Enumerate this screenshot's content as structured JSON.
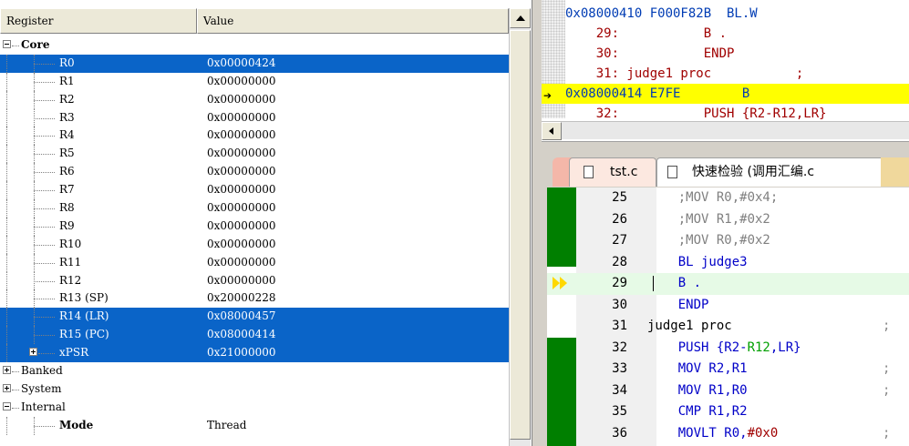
{
  "registers": {
    "header": {
      "register": "Register",
      "value": "Value"
    },
    "rows": [
      {
        "name": "Core",
        "value": "",
        "level": 0,
        "expander": "minus",
        "bold": true,
        "selected": false
      },
      {
        "name": "R0",
        "value": "0x00000424",
        "level": 2,
        "selected": true
      },
      {
        "name": "R1",
        "value": "0x00000000",
        "level": 2,
        "selected": false
      },
      {
        "name": "R2",
        "value": "0x00000000",
        "level": 2,
        "selected": false
      },
      {
        "name": "R3",
        "value": "0x00000000",
        "level": 2,
        "selected": false
      },
      {
        "name": "R4",
        "value": "0x00000000",
        "level": 2,
        "selected": false
      },
      {
        "name": "R5",
        "value": "0x00000000",
        "level": 2,
        "selected": false
      },
      {
        "name": "R6",
        "value": "0x00000000",
        "level": 2,
        "selected": false
      },
      {
        "name": "R7",
        "value": "0x00000000",
        "level": 2,
        "selected": false
      },
      {
        "name": "R8",
        "value": "0x00000000",
        "level": 2,
        "selected": false
      },
      {
        "name": "R9",
        "value": "0x00000000",
        "level": 2,
        "selected": false
      },
      {
        "name": "R10",
        "value": "0x00000000",
        "level": 2,
        "selected": false
      },
      {
        "name": "R11",
        "value": "0x00000000",
        "level": 2,
        "selected": false
      },
      {
        "name": "R12",
        "value": "0x00000000",
        "level": 2,
        "selected": false
      },
      {
        "name": "R13 (SP)",
        "value": "0x20000228",
        "level": 2,
        "selected": false
      },
      {
        "name": "R14 (LR)",
        "value": "0x08000457",
        "level": 2,
        "selected": true
      },
      {
        "name": "R15 (PC)",
        "value": "0x08000414",
        "level": 2,
        "selected": true
      },
      {
        "name": "xPSR",
        "value": "0x21000000",
        "level": 1,
        "expander": "plus",
        "selected": true
      },
      {
        "name": "Banked",
        "value": "",
        "level": 0,
        "expander": "plus",
        "selected": false
      },
      {
        "name": "System",
        "value": "",
        "level": 0,
        "expander": "plus",
        "selected": false
      },
      {
        "name": "Internal",
        "value": "",
        "level": 0,
        "expander": "minus",
        "selected": false
      },
      {
        "name": "Mode",
        "value": "Thread",
        "level": 2,
        "bold": true,
        "selected": false
      }
    ]
  },
  "disassembly": {
    "lines": [
      {
        "text": "0x08000410 F000F82B  BL.W",
        "type": "addr",
        "current": false
      },
      {
        "text": "    29:           B .",
        "type": "src",
        "current": false
      },
      {
        "text": "    30:           ENDP",
        "type": "src",
        "current": false
      },
      {
        "text": "    31: judge1 proc           ;",
        "type": "src",
        "current": false
      },
      {
        "text": "0x08000414 E7FE        B",
        "type": "addr",
        "current": true
      },
      {
        "text": "    32:           PUSH {R2-R12,LR}",
        "type": "src",
        "current": false
      }
    ],
    "current_arrow": "➔"
  },
  "tabs": [
    {
      "label": "tst.c",
      "active": false
    },
    {
      "label": "快速检验 (调用汇编.c",
      "active": true
    }
  ],
  "editor": {
    "lines": [
      {
        "no": "25",
        "parts": [
          {
            "t": "    ;MOV R0,#0x4;",
            "c": "comment"
          }
        ],
        "trail": ""
      },
      {
        "no": "26",
        "parts": [
          {
            "t": "    ;MOV R1,#0x2",
            "c": "comment"
          }
        ],
        "trail": ""
      },
      {
        "no": "27",
        "parts": [
          {
            "t": "    ;MOV R0,#0x2",
            "c": "comment"
          }
        ],
        "trail": ""
      },
      {
        "no": "28",
        "parts": [
          {
            "t": "    BL judge3",
            "c": "kw"
          }
        ],
        "trail": ""
      },
      {
        "no": "29",
        "parts": [
          {
            "t": "    B .",
            "c": "kw"
          }
        ],
        "trail": "",
        "highlight": true,
        "exec": true
      },
      {
        "no": "30",
        "parts": [
          {
            "t": "    ENDP",
            "c": "kw"
          }
        ],
        "trail": ""
      },
      {
        "no": "31",
        "parts": [
          {
            "t": "judge1 proc",
            "c": "plain"
          }
        ],
        "trail": ";"
      },
      {
        "no": "32",
        "parts": [
          {
            "t": "    PUSH {R2-",
            "c": "kw"
          },
          {
            "t": "R12",
            "c": "green"
          },
          {
            "t": ",LR}",
            "c": "kw"
          }
        ],
        "trail": ""
      },
      {
        "no": "33",
        "parts": [
          {
            "t": "    MOV R2,R1",
            "c": "kw"
          }
        ],
        "trail": ";"
      },
      {
        "no": "34",
        "parts": [
          {
            "t": "    MOV R1,R0",
            "c": "kw"
          }
        ],
        "trail": ";"
      },
      {
        "no": "35",
        "parts": [
          {
            "t": "    CMP R1,R2",
            "c": "kw"
          }
        ],
        "trail": ""
      },
      {
        "no": "36",
        "parts": [
          {
            "t": "    MOVLT R0,",
            "c": "kw"
          },
          {
            "t": "#0x0",
            "c": "num"
          }
        ],
        "trail": ";"
      }
    ]
  },
  "colors": {
    "selection": "#0a64c8",
    "current_line": "#ffff00",
    "exec_marker": "#007f00",
    "keyword": "#0000c8"
  }
}
